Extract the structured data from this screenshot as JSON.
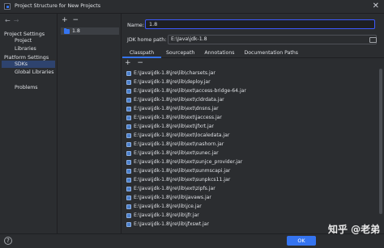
{
  "window": {
    "title": "Project Structure for New Projects",
    "close_glyph": "✕"
  },
  "left": {
    "back_glyph": "←",
    "forward_glyph": "→",
    "project_settings_heading": "Project Settings",
    "project_items": [
      "Project",
      "Libraries"
    ],
    "platform_settings_heading": "Platform Settings",
    "platform_items": [
      "SDKs",
      "Global Libraries"
    ],
    "other_items": [
      "Problems"
    ]
  },
  "middle": {
    "add_glyph": "+",
    "remove_glyph": "−",
    "sdk_name": "1.8"
  },
  "form": {
    "name_label": "Name:",
    "name_value": "1.8",
    "home_label": "JDK home path:",
    "home_value": "E:\\Java\\jdk-1.8"
  },
  "tabs": [
    "Classpath",
    "Sourcepath",
    "Annotations",
    "Documentation Paths"
  ],
  "list_tools": {
    "add_glyph": "+",
    "remove_glyph": "−"
  },
  "classpath": [
    "E:\\Java\\jdk-1.8\\jre\\lib\\charsets.jar",
    "E:\\Java\\jdk-1.8\\jre\\lib\\deploy.jar",
    "E:\\Java\\jdk-1.8\\jre\\lib\\ext\\access-bridge-64.jar",
    "E:\\Java\\jdk-1.8\\jre\\lib\\ext\\cldrdata.jar",
    "E:\\Java\\jdk-1.8\\jre\\lib\\ext\\dnsns.jar",
    "E:\\Java\\jdk-1.8\\jre\\lib\\ext\\jaccess.jar",
    "E:\\Java\\jdk-1.8\\jre\\lib\\ext\\jfxrt.jar",
    "E:\\Java\\jdk-1.8\\jre\\lib\\ext\\localedata.jar",
    "E:\\Java\\jdk-1.8\\jre\\lib\\ext\\nashorn.jar",
    "E:\\Java\\jdk-1.8\\jre\\lib\\ext\\sunec.jar",
    "E:\\Java\\jdk-1.8\\jre\\lib\\ext\\sunjce_provider.jar",
    "E:\\Java\\jdk-1.8\\jre\\lib\\ext\\sunmscapi.jar",
    "E:\\Java\\jdk-1.8\\jre\\lib\\ext\\sunpkcs11.jar",
    "E:\\Java\\jdk-1.8\\jre\\lib\\ext\\zipfs.jar",
    "E:\\Java\\jdk-1.8\\jre\\lib\\javaws.jar",
    "E:\\Java\\jdk-1.8\\jre\\lib\\jce.jar",
    "E:\\Java\\jdk-1.8\\jre\\lib\\jfr.jar",
    "E:\\Java\\jdk-1.8\\jre\\lib\\jfxswt.jar"
  ],
  "footer": {
    "help_glyph": "?",
    "ok_label": "OK"
  },
  "watermark": "知乎 @老弟",
  "colors": {
    "accent": "#3574f0",
    "selection": "#2e436e",
    "background": "#2b2d30"
  }
}
